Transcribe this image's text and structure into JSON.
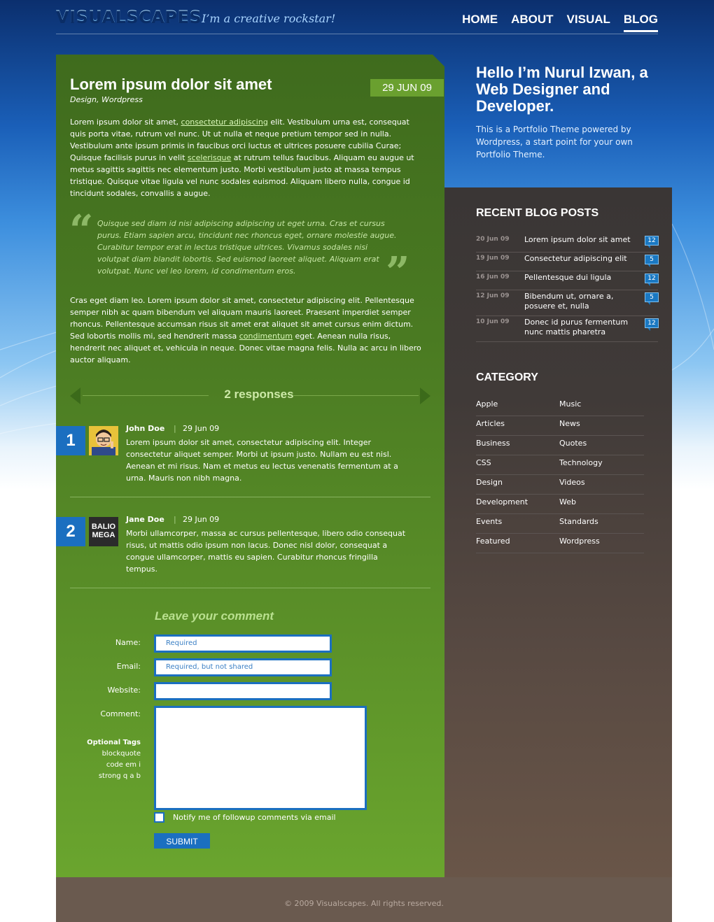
{
  "header": {
    "logo": "VISUALSCAPES",
    "tagline": "I’m a creative rockstar!",
    "nav": [
      "HOME",
      "ABOUT",
      "VISUAL",
      "BLOG"
    ]
  },
  "post": {
    "title": "Lorem ipsum dolor sit amet",
    "categories": "Design, Wordpress",
    "date": "29 JUN 09",
    "p1_a": "Lorem ipsum dolor sit amet, ",
    "p1_link1": "consectetur adipiscing",
    "p1_b": " elit. Vestibulum urna est, consequat quis porta vitae, rutrum vel nunc. Ut ut nulla et neque pretium tempor sed in nulla. Vestibulum ante ipsum primis in faucibus orci luctus et ultrices posuere cubilia Curae; Quisque facilisis purus in velit ",
    "p1_link2": "scelerisque",
    "p1_c": " at rutrum tellus faucibus. Aliquam eu augue ut metus sagittis sagittis nec elementum justo. Morbi vestibulum justo at massa tempus tristique. Quisque vitae ligula vel nunc sodales euismod. Aliquam libero nulla, congue id tincidunt sodales, convallis a augue.",
    "quote": "Quisque sed diam id nisi adipiscing adipiscing ut eget urna. Cras et cursus purus. Etiam sapien arcu, tincidunt nec rhoncus eget, ornare molestie augue. Curabitur tempor erat in lectus tristique ultrices. Vivamus sodales nisi volutpat diam blandit lobortis. Sed euismod laoreet aliquet. Aliquam erat volutpat. Nunc vel leo lorem, id condimentum eros.",
    "p2_a": "Cras eget diam leo. Lorem ipsum dolor sit amet, consectetur adipiscing elit. Pellentesque semper nibh ac quam bibendum vel aliquam mauris laoreet. Praesent imperdiet semper rhoncus. Pellentesque accumsan risus sit amet erat aliquet sit amet cursus enim dictum. Sed lobortis mollis mi, sed hendrerit massa ",
    "p2_link": "condimentum",
    "p2_b": " eget. Aenean nulla risus, hendrerit nec aliquet et, vehicula in neque. Donec vitae magna felis. Nulla ac arcu in libero auctor aliquam."
  },
  "responses": "2 responses",
  "comments": [
    {
      "number": "1",
      "author": "John Doe",
      "sep": "|",
      "date": "29 Jun 09",
      "text": "Lorem ipsum dolor sit amet, consectetur adipiscing elit. Integer consectetur aliquet semper. Morbi ut ipsum justo. Nullam eu est nisl. Aenean et mi risus. Nam et metus eu lectus venenatis fermentum at a urna. Mauris non nibh magna."
    },
    {
      "number": "2",
      "author": "Jane Doe",
      "sep": "|",
      "date": "29 Jun 09",
      "avatar_text_1": "BALIO",
      "avatar_text_2": "MEGA",
      "text": "Morbi ullamcorper, massa ac cursus pellentesque, libero odio consequat risus, ut mattis odio ipsum non lacus. Donec nisl dolor, consequat a congue ullamcorper, mattis eu sapien. Curabitur rhoncus fringilla tempus."
    }
  ],
  "form": {
    "title": "Leave your comment",
    "name_label": "Name:",
    "name_placeholder": "Required",
    "email_label": "Email:",
    "email_placeholder": "Required, but not shared",
    "website_label": "Website:",
    "comment_label": "Comment:",
    "tags_title": "Optional Tags",
    "tags_line1": "blockquote",
    "tags_line2": "code em i",
    "tags_line3": "strong q a b",
    "notify_label": "Notify me of followup comments via email",
    "submit_label": "SUBMIT"
  },
  "sidebar": {
    "intro_title": "Hello I’m Nurul Izwan, a Web Designer and Developer.",
    "intro_text": "This is a Portfolio Theme powered by Wordpress, a start point for your own Portfolio Theme.",
    "recent_heading": "RECENT BLOG POSTS",
    "recent": [
      {
        "date": "20 Jun 09",
        "title": "Lorem ipsum dolor sit amet",
        "count": "12"
      },
      {
        "date": "19 Jun 09",
        "title": "Consectetur adipiscing elit",
        "count": "5"
      },
      {
        "date": "16 Jun 09",
        "title": "Pellentesque dui ligula",
        "count": "12"
      },
      {
        "date": "12 Jun 09",
        "title": "Bibendum ut, ornare a, posuere et, nulla",
        "count": "5"
      },
      {
        "date": "10 Jun 09",
        "title": "Donec id purus fermentum nunc mattis pharetra",
        "count": "12"
      }
    ],
    "category_heading": "CATEGORY",
    "categories": [
      "Apple",
      "Music",
      "Articles",
      "News",
      "Business",
      "Quotes",
      "CSS",
      "Technology",
      "Design",
      "Videos",
      "Development",
      "Web",
      "Events",
      "Standards",
      "Featured",
      "Wordpress"
    ]
  },
  "footer": "© 2009 Visualscapes. All rights reserved.",
  "colors": {
    "accent_blue": "#1b6fc0",
    "panel_green": "#4a7a22",
    "sidebar_dark": "#3a3635"
  }
}
